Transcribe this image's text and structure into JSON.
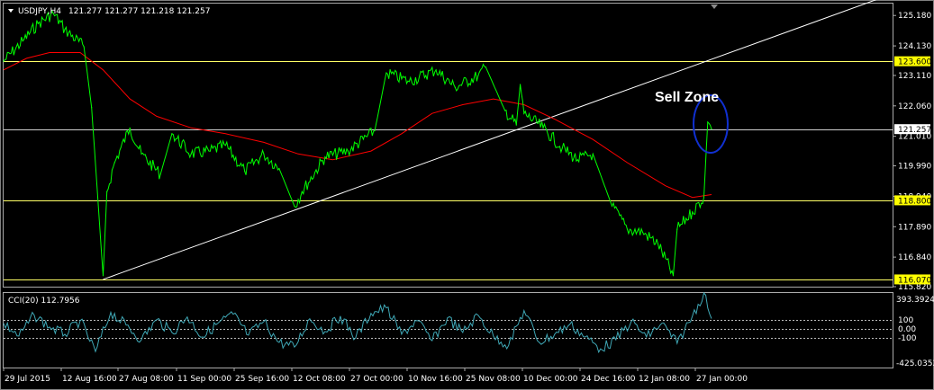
{
  "header": {
    "menu_icon": "dropdown-triangle-icon",
    "symbol": "USDJPY,H4",
    "quotes": "121.277 121.277 121.218 121.257"
  },
  "indicator": {
    "label": "CCI(20) 112.7956",
    "top_label": "393.3924",
    "bottom_label": "-425.0352",
    "levels": [
      "100",
      "0.00",
      "-100"
    ]
  },
  "annotation": {
    "text": "Sell Zone"
  },
  "colors": {
    "background": "#000000",
    "price": "#00ff00",
    "moving_average": "#ff0000",
    "trendline": "#ffffff",
    "horizontal_levels": "#ffff66",
    "cci": "#3fa7b5",
    "highlight_ellipse": "#1030d0",
    "frame": "#aaaaaa"
  },
  "chart_data": [
    {
      "type": "line",
      "title": "USDJPY,H4",
      "x": [
        "29 Jul 2015",
        "12 Aug 16:00",
        "27 Aug 08:00",
        "11 Sep 00:00",
        "25 Sep 16:00",
        "12 Oct 08:00",
        "27 Oct 00:00",
        "10 Nov 16:00",
        "25 Nov 08:00",
        "10 Dec 00:00",
        "24 Dec 16:00",
        "12 Jan 08:00",
        "27 Jan 00:00"
      ],
      "ylim": [
        115.82,
        125.59
      ],
      "y_ticks": [
        "125.180",
        "124.130",
        "123.110",
        "122.060",
        "121.010",
        "119.990",
        "118.940",
        "117.890",
        "116.840",
        "115.820"
      ],
      "price_tags": [
        {
          "label": "123.600",
          "value": 123.6,
          "style": "yellow"
        },
        {
          "label": "121.257",
          "value": 121.257,
          "style": "white"
        },
        {
          "label": "118.800",
          "value": 118.8,
          "style": "yellow"
        },
        {
          "label": "116.070",
          "value": 116.07,
          "style": "yellow"
        }
      ],
      "horizontal_levels": [
        123.6,
        121.257,
        118.8,
        116.07
      ],
      "trendline": {
        "start": {
          "x": "24 Aug 2015",
          "y": 116.07
        },
        "end": {
          "x": "3 Feb 2016",
          "y": 123.86
        }
      },
      "series": [
        {
          "name": "",
          "role": "price",
          "points": [
            [
              "29 Jul 2015",
              123.6
            ],
            [
              "3 Aug 2015",
              124.3
            ],
            [
              "7 Aug 2015",
              124.9
            ],
            [
              "11 Aug 2015",
              125.25
            ],
            [
              "14 Aug 2015",
              124.7
            ],
            [
              "19 Aug 2015",
              124.1
            ],
            [
              "21 Aug 2015",
              122.0
            ],
            [
              "24 Aug 2015",
              116.2
            ],
            [
              "25 Aug 2015",
              119.1
            ],
            [
              "27 Aug 2015",
              120.1
            ],
            [
              "31 Aug 2015",
              121.3
            ],
            [
              "3 Sep 2015",
              120.4
            ],
            [
              "8 Sep 2015",
              119.7
            ],
            [
              "11 Sep 2015",
              121.1
            ],
            [
              "16 Sep 2015",
              120.4
            ],
            [
              "21 Sep 2015",
              120.5
            ],
            [
              "25 Sep 2015",
              120.7
            ],
            [
              "30 Sep 2015",
              119.8
            ],
            [
              "5 Oct 2015",
              120.4
            ],
            [
              "9 Oct 2015",
              119.9
            ],
            [
              "13 Oct 2015",
              118.6
            ],
            [
              "15 Oct 2015",
              119.1
            ],
            [
              "21 Oct 2015",
              120.3
            ],
            [
              "27 Oct 2015",
              120.5
            ],
            [
              "3 Nov 2015",
              121.2
            ],
            [
              "6 Nov 2015",
              123.2
            ],
            [
              "12 Nov 2015",
              122.9
            ],
            [
              "19 Nov 2015",
              123.3
            ],
            [
              "24 Nov 2015",
              122.7
            ],
            [
              "30 Nov 2015",
              123.1
            ],
            [
              "2 Dec 2015",
              123.4
            ],
            [
              "7 Dec 2015",
              121.9
            ],
            [
              "10 Dec 2015",
              121.4
            ],
            [
              "11 Dec 2015",
              122.8
            ],
            [
              "12 Dec 2015",
              121.8
            ],
            [
              "17 Dec 2015",
              121.3
            ],
            [
              "22 Dec 2015",
              120.6
            ],
            [
              "26 Dec 2015",
              120.2
            ],
            [
              "30 Dec 2015",
              120.4
            ],
            [
              "4 Jan 2016",
              118.6
            ],
            [
              "8 Jan 2016",
              117.8
            ],
            [
              "12 Jan 2016",
              117.7
            ],
            [
              "16 Jan 2016",
              117.3
            ],
            [
              "20 Jan 2016",
              116.2
            ],
            [
              "21 Jan 2016",
              117.8
            ],
            [
              "25 Jan 2016",
              118.4
            ],
            [
              "28 Jan 2016",
              118.9
            ],
            [
              "29 Jan 2016",
              121.5
            ],
            [
              "30 Jan 2016",
              121.257
            ]
          ]
        },
        {
          "name": "",
          "role": "moving_average",
          "points": [
            [
              "29 Jul 2015",
              123.3
            ],
            [
              "4 Aug 2015",
              123.7
            ],
            [
              "10 Aug 2015",
              123.9
            ],
            [
              "18 Aug 2015",
              123.9
            ],
            [
              "24 Aug 2015",
              123.3
            ],
            [
              "31 Aug 2015",
              122.3
            ],
            [
              "7 Sep 2015",
              121.7
            ],
            [
              "16 Sep 2015",
              121.3
            ],
            [
              "25 Sep 2015",
              121.1
            ],
            [
              "5 Oct 2015",
              120.8
            ],
            [
              "14 Oct 2015",
              120.4
            ],
            [
              "23 Oct 2015",
              120.2
            ],
            [
              "2 Nov 2015",
              120.5
            ],
            [
              "10 Nov 2015",
              121.1
            ],
            [
              "18 Nov 2015",
              121.8
            ],
            [
              "26 Nov 2015",
              122.1
            ],
            [
              "4 Dec 2015",
              122.3
            ],
            [
              "12 Dec 2015",
              122.1
            ],
            [
              "20 Dec 2015",
              121.6
            ],
            [
              "30 Dec 2015",
              120.9
            ],
            [
              "8 Jan 2016",
              120.1
            ],
            [
              "18 Jan 2016",
              119.3
            ],
            [
              "25 Jan 2016",
              118.9
            ],
            [
              "30 Jan 2016",
              119.0
            ]
          ]
        }
      ]
    },
    {
      "type": "line",
      "title": "CCI(20) 112.7956",
      "ylim": [
        -425.0352,
        393.3924
      ],
      "levels": [
        100,
        0,
        -100
      ],
      "series": [
        {
          "name": "",
          "role": "cci",
          "points": [
            [
              "29 Jul 2015",
              60
            ],
            [
              "2 Aug 2015",
              -80
            ],
            [
              "6 Aug 2015",
              150
            ],
            [
              "10 Aug 2015",
              20
            ],
            [
              "14 Aug 2015",
              -60
            ],
            [
              "18 Aug 2015",
              90
            ],
            [
              "22 Aug 2015",
              -250
            ],
            [
              "26 Aug 2015",
              180
            ],
            [
              "30 Aug 2015",
              40
            ],
            [
              "3 Sep 2015",
              -120
            ],
            [
              "7 Sep 2015",
              100
            ],
            [
              "11 Sep 2015",
              -40
            ],
            [
              "15 Sep 2015",
              130
            ],
            [
              "19 Sep 2015",
              -90
            ],
            [
              "23 Sep 2015",
              60
            ],
            [
              "27 Sep 2015",
              160
            ],
            [
              "1 Oct 2015",
              -70
            ],
            [
              "5 Oct 2015",
              80
            ],
            [
              "9 Oct 2015",
              -150
            ],
            [
              "13 Oct 2015",
              -200
            ],
            [
              "17 Oct 2015",
              110
            ],
            [
              "21 Oct 2015",
              -30
            ],
            [
              "25 Oct 2015",
              140
            ],
            [
              "29 Oct 2015",
              -100
            ],
            [
              "2 Nov 2015",
              170
            ],
            [
              "6 Nov 2015",
              230
            ],
            [
              "10 Nov 2015",
              -60
            ],
            [
              "14 Nov 2015",
              90
            ],
            [
              "18 Nov 2015",
              -130
            ],
            [
              "22 Nov 2015",
              120
            ],
            [
              "26 Nov 2015",
              -40
            ],
            [
              "30 Nov 2015",
              150
            ],
            [
              "4 Dec 2015",
              -80
            ],
            [
              "8 Dec 2015",
              -180
            ],
            [
              "12 Dec 2015",
              200
            ],
            [
              "16 Dec 2015",
              -150
            ],
            [
              "20 Dec 2015",
              -60
            ],
            [
              "24 Dec 2015",
              50
            ],
            [
              "28 Dec 2015",
              -90
            ],
            [
              "1 Jan 2016",
              -220
            ],
            [
              "5 Jan 2016",
              -120
            ],
            [
              "9 Jan 2016",
              80
            ],
            [
              "13 Jan 2016",
              -90
            ],
            [
              "17 Jan 2016",
              60
            ],
            [
              "21 Jan 2016",
              -160
            ],
            [
              "25 Jan 2016",
              140
            ],
            [
              "28 Jan 2016",
              393.39
            ],
            [
              "30 Jan 2016",
              112.7956
            ]
          ]
        }
      ]
    }
  ]
}
